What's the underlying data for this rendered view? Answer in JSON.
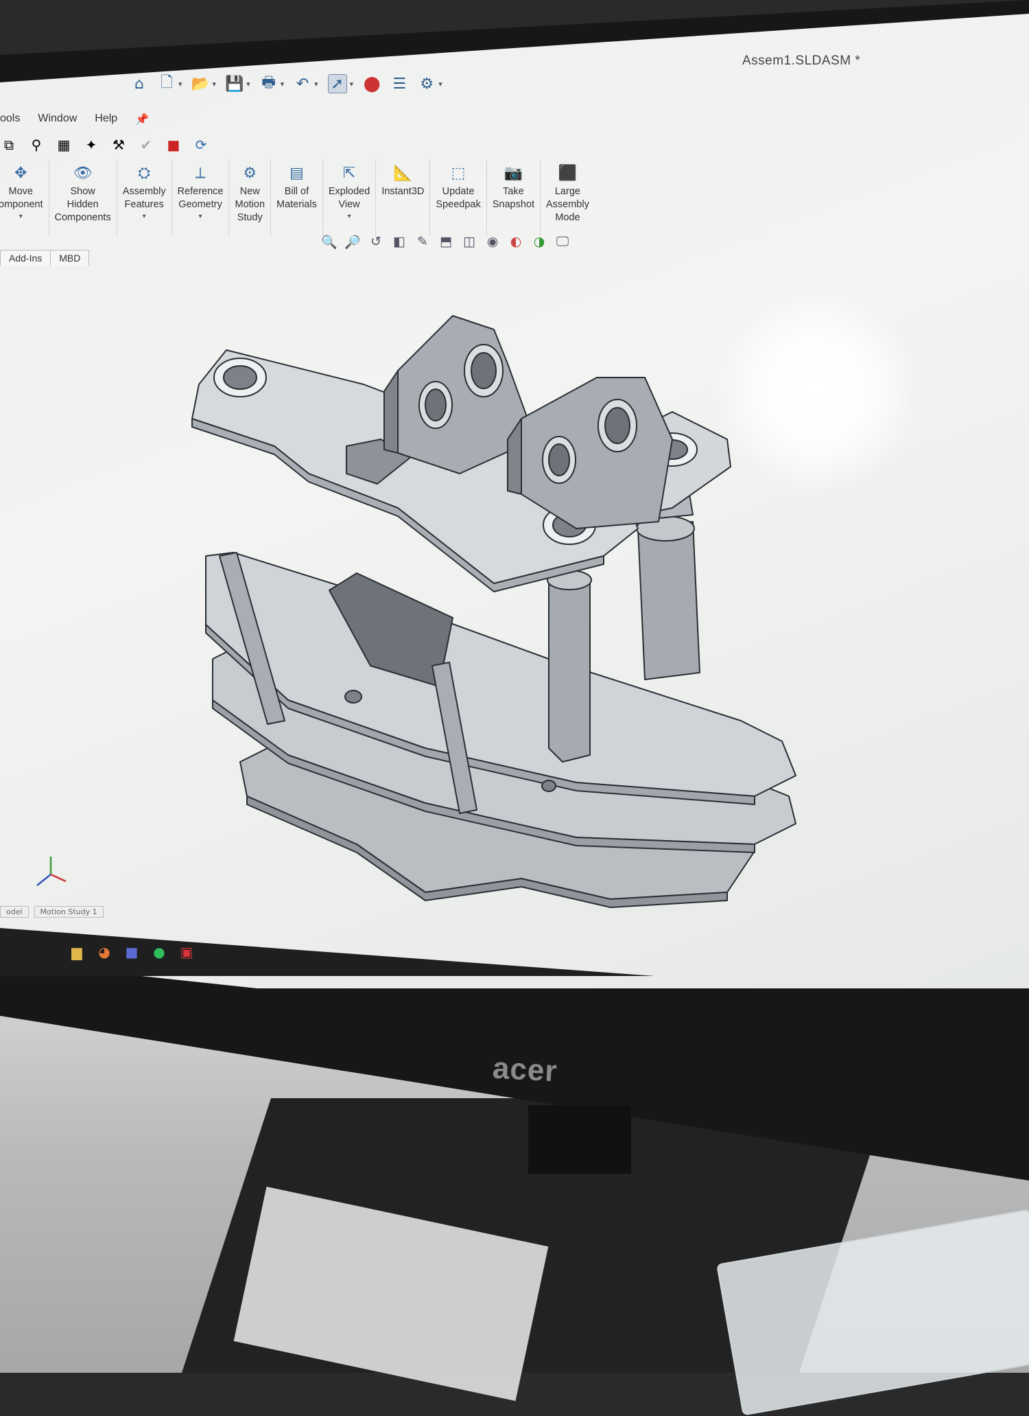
{
  "window": {
    "title": "Assem1.SLDASM *"
  },
  "menubar": {
    "items": [
      "ools",
      "Window",
      "Help"
    ]
  },
  "ribbon": {
    "buttons": [
      {
        "label": "Move\nomponent",
        "icon": "move-component-icon",
        "dropdown": true
      },
      {
        "label": "Show\nHidden\nComponents",
        "icon": "show-hidden-icon",
        "dropdown": false
      },
      {
        "label": "Assembly\nFeatures",
        "icon": "assembly-features-icon",
        "dropdown": true
      },
      {
        "label": "Reference\nGeometry",
        "icon": "reference-geometry-icon",
        "dropdown": true
      },
      {
        "label": "New\nMotion\nStudy",
        "icon": "motion-study-icon",
        "dropdown": false
      },
      {
        "label": "Bill of\nMaterials",
        "icon": "bom-icon",
        "dropdown": false
      },
      {
        "label": "Exploded\nView",
        "icon": "exploded-view-icon",
        "dropdown": true
      },
      {
        "label": "Instant3D",
        "icon": "instant3d-icon",
        "dropdown": false
      },
      {
        "label": "Update\nSpeedpak",
        "icon": "speedpak-icon",
        "dropdown": false
      },
      {
        "label": "Take\nSnapshot",
        "icon": "camera-icon",
        "dropdown": false
      },
      {
        "label": "Large\nAssembly\nMode",
        "icon": "large-assembly-icon",
        "dropdown": false
      }
    ]
  },
  "tabs": [
    "Add-Ins",
    "MBD"
  ],
  "bottom_tabs": [
    "odel",
    "Motion Study 1"
  ],
  "brand": "acer"
}
